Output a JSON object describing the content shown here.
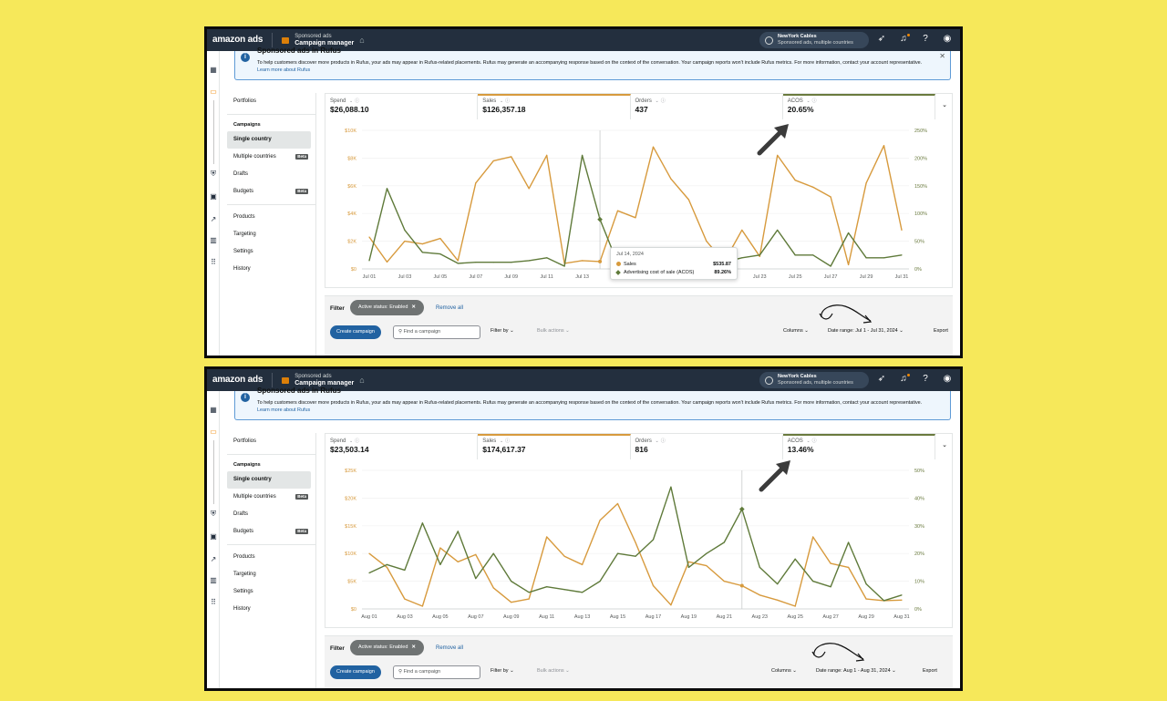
{
  "topbar": {
    "logo": "amazon ads",
    "product_line1": "Sponsored ads",
    "product_line2": "Campaign manager",
    "account_name": "NewYork Cables",
    "account_sub": "Sponsored ads, multiple countries"
  },
  "banner": {
    "title": "Sponsored ads in Rufus",
    "text": "To help customers discover more products in Rufus, your ads may appear in Rufus-related placements. Rufus may generate an accompanying response based on the context of the conversation. Your campaign reports won't include Rufus metrics. For more information, contact your account representative.",
    "link": "Learn more about Rufus"
  },
  "nav": {
    "portfolios": "Portfolios",
    "campaigns": "Campaigns",
    "single_country": "Single country",
    "multiple_countries": "Multiple countries",
    "drafts": "Drafts",
    "budgets": "Budgets",
    "beta": "Beta",
    "products": "Products",
    "targeting": "Targeting",
    "settings": "Settings",
    "history": "History"
  },
  "filter": {
    "label": "Filter",
    "chip": "Active status: Enabled",
    "remove_all": "Remove all",
    "create": "Create campaign",
    "search_placeholder": "Find a campaign",
    "filter_by": "Filter by",
    "bulk": "Bulk actions",
    "columns": "Columns",
    "export": "Export"
  },
  "colors": {
    "sales": "#d79a3d",
    "acos": "#5f7a3a",
    "accent": "#2162a1",
    "topbar": "#232f3e"
  },
  "screens": [
    {
      "metrics": {
        "spend_label": "Spend",
        "spend": "$26,088.10",
        "sales_label": "Sales",
        "sales": "$126,357.18",
        "orders_label": "Orders",
        "orders": "437",
        "acos_label": "ACOS",
        "acos": "20.65%"
      },
      "date_range": "Date range: Jul 1 - Jul 31, 2024",
      "tooltip": {
        "date": "Jul 14, 2024",
        "sales_label": "Sales",
        "sales_value": "$535.87",
        "acos_label": "Advertising cost of sale (ACOS)",
        "acos_value": "89.26%"
      }
    },
    {
      "metrics": {
        "spend_label": "Spend",
        "spend": "$23,503.14",
        "sales_label": "Sales",
        "sales": "$174,617.37",
        "orders_label": "Orders",
        "orders": "816",
        "acos_label": "ACOS",
        "acos": "13.46%"
      },
      "date_range": "Date range: Aug 1 - Aug 31, 2024"
    }
  ],
  "chart_data": [
    {
      "type": "line",
      "x": [
        "Jul 01",
        "Jul 02",
        "Jul 03",
        "Jul 04",
        "Jul 05",
        "Jul 06",
        "Jul 07",
        "Jul 08",
        "Jul 09",
        "Jul 10",
        "Jul 11",
        "Jul 12",
        "Jul 13",
        "Jul 14",
        "Jul 15",
        "Jul 16",
        "Jul 17",
        "Jul 18",
        "Jul 19",
        "Jul 20",
        "Jul 21",
        "Jul 22",
        "Jul 23",
        "Jul 24",
        "Jul 25",
        "Jul 26",
        "Jul 27",
        "Jul 28",
        "Jul 29",
        "Jul 30",
        "Jul 31"
      ],
      "xticks": [
        "Jul 01",
        "Jul 03",
        "Jul 05",
        "Jul 07",
        "Jul 09",
        "Jul 11",
        "Jul 13",
        "Jul 23",
        "Jul 25",
        "Jul 27",
        "Jul 29",
        "Jul 31"
      ],
      "yticks_left": [
        "$0",
        "$2K",
        "$4K",
        "$6K",
        "$8K",
        "$10K"
      ],
      "yticks_right": [
        "0%",
        "50%",
        "100%",
        "150%",
        "200%",
        "250%"
      ],
      "ylim_left": [
        0,
        10000
      ],
      "ylim_right": [
        0,
        250
      ],
      "series": [
        {
          "name": "Sales",
          "axis": "left",
          "values": [
            2300,
            500,
            2000,
            1800,
            2200,
            600,
            6200,
            7800,
            8100,
            5800,
            8200,
            400,
            600,
            535.87,
            4200,
            3700,
            8800,
            6500,
            5000,
            2000,
            500,
            2800,
            900,
            8200,
            6400,
            5900,
            5200,
            300,
            6200,
            8900,
            2800
          ]
        },
        {
          "name": "Advertising cost of sale (ACOS)",
          "axis": "right",
          "values": [
            15,
            145,
            70,
            30,
            27,
            10,
            12,
            12,
            12,
            15,
            20,
            5,
            205,
            89.26,
            10,
            13,
            12,
            10,
            12,
            12,
            12,
            20,
            25,
            70,
            25,
            25,
            5,
            65,
            20,
            20,
            25
          ]
        }
      ]
    },
    {
      "type": "line",
      "x": [
        "Aug 01",
        "Aug 02",
        "Aug 03",
        "Aug 04",
        "Aug 05",
        "Aug 06",
        "Aug 07",
        "Aug 08",
        "Aug 09",
        "Aug 10",
        "Aug 11",
        "Aug 12",
        "Aug 13",
        "Aug 14",
        "Aug 15",
        "Aug 16",
        "Aug 17",
        "Aug 18",
        "Aug 19",
        "Aug 20",
        "Aug 21",
        "Aug 22",
        "Aug 23",
        "Aug 24",
        "Aug 25",
        "Aug 26",
        "Aug 27",
        "Aug 28",
        "Aug 29",
        "Aug 30",
        "Aug 31"
      ],
      "xticks": [
        "Aug 01",
        "Aug 03",
        "Aug 05",
        "Aug 07",
        "Aug 09",
        "Aug 11",
        "Aug 13",
        "Aug 15",
        "Aug 17",
        "Aug 19",
        "Aug 21",
        "Aug 23",
        "Aug 25",
        "Aug 27",
        "Aug 29",
        "Aug 31"
      ],
      "yticks_left": [
        "$0",
        "$5K",
        "$10K",
        "$15K",
        "$20K",
        "$25K"
      ],
      "yticks_right": [
        "0%",
        "10%",
        "20%",
        "30%",
        "40%",
        "50%"
      ],
      "ylim_left": [
        0,
        25000
      ],
      "ylim_right": [
        0,
        50
      ],
      "series": [
        {
          "name": "Sales",
          "axis": "left",
          "values": [
            10000,
            7500,
            1800,
            500,
            11000,
            8500,
            9800,
            3800,
            1200,
            1800,
            13000,
            9500,
            8000,
            16000,
            19000,
            12000,
            4200,
            700,
            8500,
            7800,
            5000,
            4200,
            2500,
            1600,
            500,
            13000,
            8200,
            7500,
            1800,
            1500,
            1600
          ]
        },
        {
          "name": "Advertising cost of sale (ACOS)",
          "axis": "right",
          "values": [
            13,
            16,
            14,
            31,
            16,
            28,
            11,
            20,
            10,
            6,
            8,
            7,
            6,
            10,
            20,
            19,
            25,
            44,
            15,
            20,
            24,
            36,
            15,
            9,
            18,
            10,
            8,
            24,
            9,
            3,
            5
          ]
        }
      ]
    }
  ]
}
